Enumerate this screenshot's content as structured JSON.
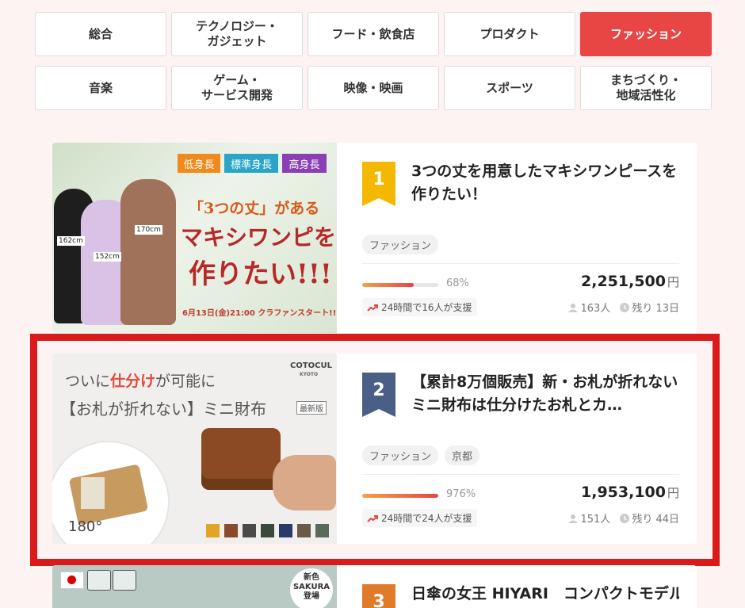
{
  "tabs": [
    {
      "label": "総合",
      "active": false
    },
    {
      "label": "テクノロジー・\nガジェット",
      "active": false
    },
    {
      "label": "フード・飲食店",
      "active": false
    },
    {
      "label": "プロダクト",
      "active": false
    },
    {
      "label": "ファッション",
      "active": true
    },
    {
      "label": "音楽",
      "active": false
    },
    {
      "label": "ゲーム・\nサービス開発",
      "active": false
    },
    {
      "label": "映像・映画",
      "active": false
    },
    {
      "label": "スポーツ",
      "active": false
    },
    {
      "label": "まちづくり・\n地域活性化",
      "active": false
    }
  ],
  "projects": [
    {
      "rank": "1",
      "rank_color": "#f5b800",
      "title": "3つの丈を用意したマキシワンピースを作りたい！",
      "tags": [
        "ファッション"
      ],
      "progress_pct": 68,
      "progress_label": "68%",
      "amount": "2,251,500",
      "currency": "円",
      "support_recent": "24時間で16人が支援",
      "backers": "163人",
      "remaining": "残り 13日",
      "image": {
        "badges": [
          "低身長",
          "標準身長",
          "高身長"
        ],
        "badge_colors": [
          "#f08a1c",
          "#2aa5c8",
          "#8a3fb5"
        ],
        "headline1": "「3つの丈」がある",
        "headline2": "マキシワンピを",
        "headline3": "作りたい!!!",
        "heights": [
          "162cm",
          "152cm",
          "170cm"
        ],
        "footer": "6月13日(金)21:00 クラファンスタート!!"
      }
    },
    {
      "rank": "2",
      "rank_color": "#4a5f86",
      "title": "【累計8万個販売】新・お札が折れないミニ財布は仕分けたお札とカ…",
      "tags": [
        "ファッション",
        "京都"
      ],
      "progress_pct": 100,
      "progress_label": "976%",
      "amount": "1,953,100",
      "currency": "円",
      "support_recent": "24時間で24人が支援",
      "backers": "151人",
      "remaining": "残り 44日",
      "image": {
        "line1_a": "ついに",
        "line1_b": "仕分け",
        "line1_c": "が可能に",
        "line2": "【お札が折れない】ミニ財布",
        "new_label": "最新版",
        "brand": "COTOCUL",
        "brand_sub": "KYOTO",
        "angle": "180°",
        "swatches": [
          "#e0a526",
          "#8b4a2b",
          "#4a4a4a",
          "#3a4a3a",
          "#2b3a6b",
          "#6a5a4a",
          "#5a6a5a"
        ]
      }
    },
    {
      "rank": "3",
      "rank_color": "#e07b2a",
      "title": "日傘の女王 HIYARI　コンパクトモデル",
      "image": {
        "new_label": "新色",
        "new_name": "SAKURA",
        "new_sub": "登場"
      }
    }
  ],
  "colors": {
    "accent": "#e84545",
    "highlight": "#d81b1b"
  }
}
